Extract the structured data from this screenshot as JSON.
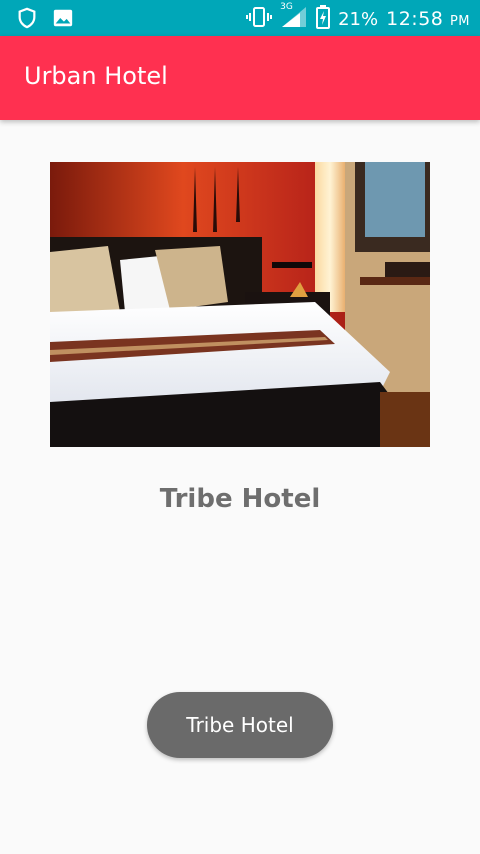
{
  "status_bar": {
    "network": "3G",
    "battery": "21%",
    "time": "12:58",
    "ampm": "PM",
    "icons": [
      "shield-icon",
      "image-icon",
      "vibrate-icon",
      "signal-icon",
      "battery-charging-icon"
    ]
  },
  "toolbar": {
    "title": "Urban Hotel",
    "color": "#ff3050"
  },
  "main": {
    "image_alt": "hotel-room-photo",
    "hotel_name": "Tribe Hotel",
    "button_label": "Tribe Hotel"
  },
  "colors": {
    "status_bar": "#00a7b8",
    "background": "#fafafa",
    "button": "#6a6a6a"
  }
}
